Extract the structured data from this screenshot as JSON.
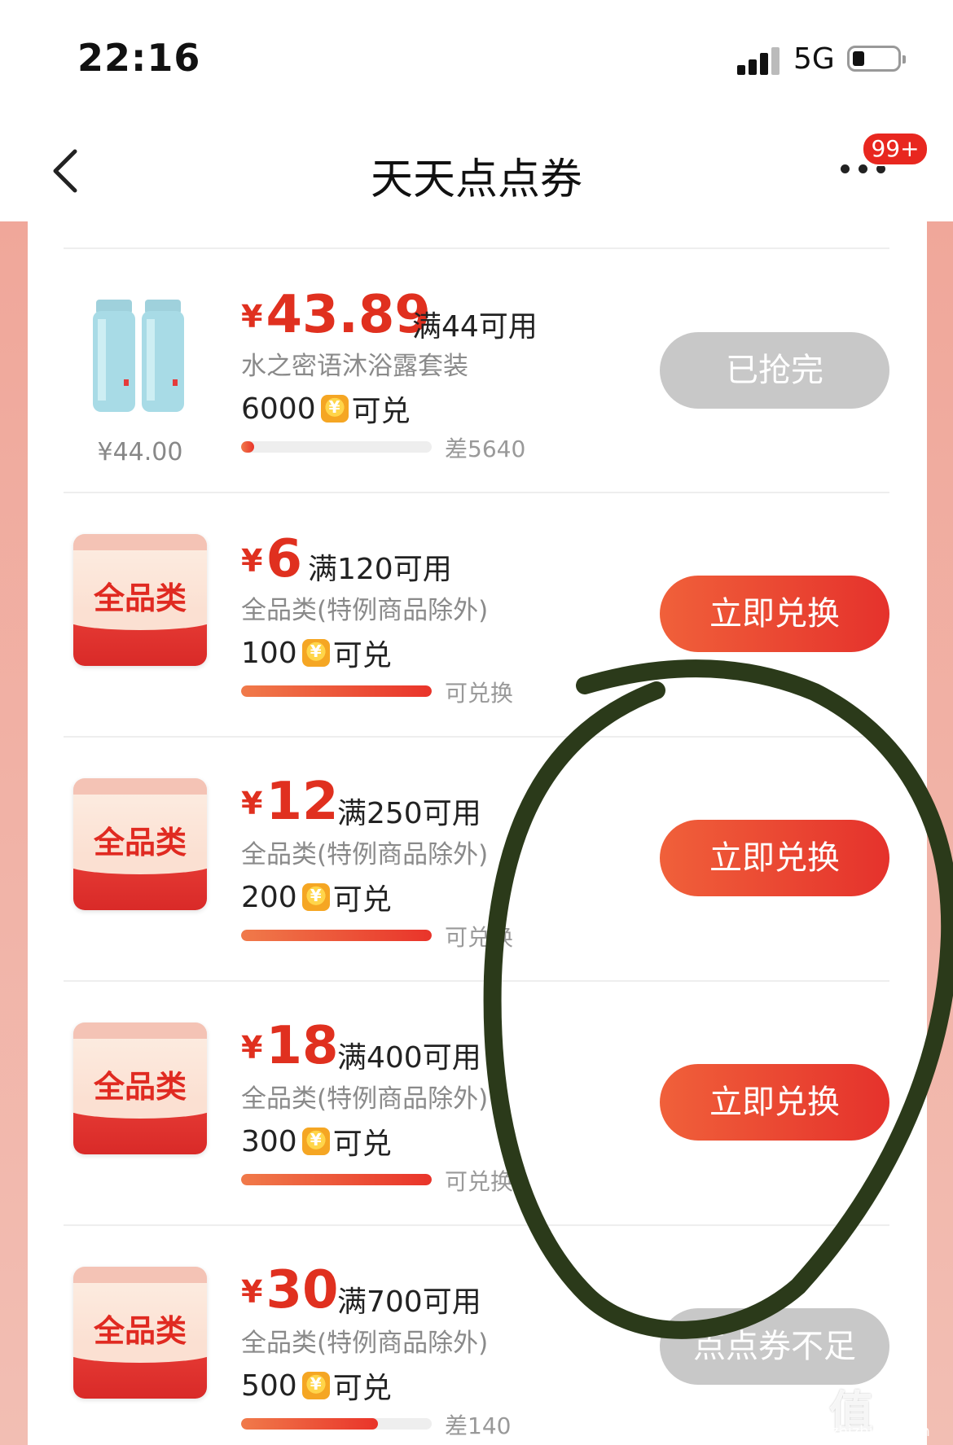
{
  "status_bar": {
    "time": "22:16",
    "network": "5G"
  },
  "nav": {
    "title": "天天点点券",
    "badge": "99+"
  },
  "rows": [
    {
      "type": "product",
      "currency": "¥",
      "price": "43.89",
      "threshold": "满44可用",
      "subtitle": "水之密语沐浴露套装",
      "cost_amount": "6000",
      "cost_suffix": "可兑",
      "progress": 0.07,
      "progress_text": "差5640",
      "button": "已抢完",
      "button_state": "sold-out",
      "original_price": "¥44.00"
    },
    {
      "type": "coupon",
      "icon_label": "全品类",
      "currency": "¥",
      "price": "6",
      "threshold": "满120可用",
      "subtitle": "全品类(特例商品除外)",
      "cost_amount": "100",
      "cost_suffix": "可兑",
      "progress": 1.0,
      "progress_text": "可兑换",
      "button": "立即兑换",
      "button_state": "active"
    },
    {
      "type": "coupon",
      "icon_label": "全品类",
      "currency": "¥",
      "price": "12",
      "threshold": "满250可用",
      "subtitle": "全品类(特例商品除外)",
      "cost_amount": "200",
      "cost_suffix": "可兑",
      "progress": 1.0,
      "progress_text": "可兑换",
      "button": "立即兑换",
      "button_state": "active"
    },
    {
      "type": "coupon",
      "icon_label": "全品类",
      "currency": "¥",
      "price": "18",
      "threshold": "满400可用",
      "subtitle": "全品类(特例商品除外)",
      "cost_amount": "300",
      "cost_suffix": "可兑",
      "progress": 1.0,
      "progress_text": "可兑换",
      "button": "立即兑换",
      "button_state": "active"
    },
    {
      "type": "coupon",
      "icon_label": "全品类",
      "currency": "¥",
      "price": "30",
      "threshold": "满700可用",
      "subtitle": "全品类(特例商品除外)",
      "cost_amount": "500",
      "cost_suffix": "可兑",
      "progress": 0.72,
      "progress_text": "差140",
      "button": "点点券不足",
      "button_state": "insufficient"
    }
  ],
  "watermark": {
    "mark": "值",
    "site": "zhizhizhi.com"
  },
  "colors": {
    "accent": "#e5322c",
    "annotation": "#2b3a1a",
    "disabled": "#c8c8c8"
  }
}
